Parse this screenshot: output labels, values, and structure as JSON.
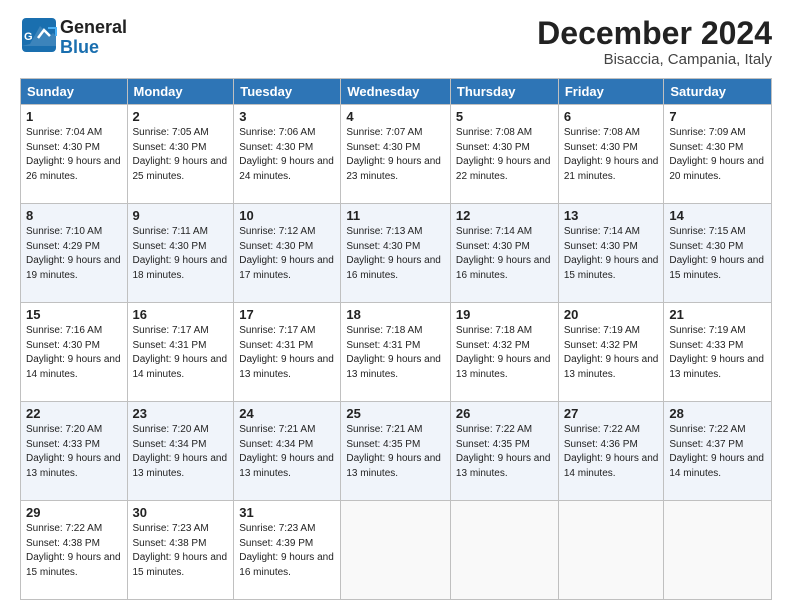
{
  "header": {
    "logo_general": "General",
    "logo_blue": "Blue",
    "month_title": "December 2024",
    "location": "Bisaccia, Campania, Italy"
  },
  "weekdays": [
    "Sunday",
    "Monday",
    "Tuesday",
    "Wednesday",
    "Thursday",
    "Friday",
    "Saturday"
  ],
  "weeks": [
    [
      {
        "day": "1",
        "sunrise": "7:04 AM",
        "sunset": "4:30 PM",
        "daylight": "9 hours and 26 minutes."
      },
      {
        "day": "2",
        "sunrise": "7:05 AM",
        "sunset": "4:30 PM",
        "daylight": "9 hours and 25 minutes."
      },
      {
        "day": "3",
        "sunrise": "7:06 AM",
        "sunset": "4:30 PM",
        "daylight": "9 hours and 24 minutes."
      },
      {
        "day": "4",
        "sunrise": "7:07 AM",
        "sunset": "4:30 PM",
        "daylight": "9 hours and 23 minutes."
      },
      {
        "day": "5",
        "sunrise": "7:08 AM",
        "sunset": "4:30 PM",
        "daylight": "9 hours and 22 minutes."
      },
      {
        "day": "6",
        "sunrise": "7:08 AM",
        "sunset": "4:30 PM",
        "daylight": "9 hours and 21 minutes."
      },
      {
        "day": "7",
        "sunrise": "7:09 AM",
        "sunset": "4:30 PM",
        "daylight": "9 hours and 20 minutes."
      }
    ],
    [
      {
        "day": "8",
        "sunrise": "7:10 AM",
        "sunset": "4:29 PM",
        "daylight": "9 hours and 19 minutes."
      },
      {
        "day": "9",
        "sunrise": "7:11 AM",
        "sunset": "4:30 PM",
        "daylight": "9 hours and 18 minutes."
      },
      {
        "day": "10",
        "sunrise": "7:12 AM",
        "sunset": "4:30 PM",
        "daylight": "9 hours and 17 minutes."
      },
      {
        "day": "11",
        "sunrise": "7:13 AM",
        "sunset": "4:30 PM",
        "daylight": "9 hours and 16 minutes."
      },
      {
        "day": "12",
        "sunrise": "7:14 AM",
        "sunset": "4:30 PM",
        "daylight": "9 hours and 16 minutes."
      },
      {
        "day": "13",
        "sunrise": "7:14 AM",
        "sunset": "4:30 PM",
        "daylight": "9 hours and 15 minutes."
      },
      {
        "day": "14",
        "sunrise": "7:15 AM",
        "sunset": "4:30 PM",
        "daylight": "9 hours and 15 minutes."
      }
    ],
    [
      {
        "day": "15",
        "sunrise": "7:16 AM",
        "sunset": "4:30 PM",
        "daylight": "9 hours and 14 minutes."
      },
      {
        "day": "16",
        "sunrise": "7:17 AM",
        "sunset": "4:31 PM",
        "daylight": "9 hours and 14 minutes."
      },
      {
        "day": "17",
        "sunrise": "7:17 AM",
        "sunset": "4:31 PM",
        "daylight": "9 hours and 13 minutes."
      },
      {
        "day": "18",
        "sunrise": "7:18 AM",
        "sunset": "4:31 PM",
        "daylight": "9 hours and 13 minutes."
      },
      {
        "day": "19",
        "sunrise": "7:18 AM",
        "sunset": "4:32 PM",
        "daylight": "9 hours and 13 minutes."
      },
      {
        "day": "20",
        "sunrise": "7:19 AM",
        "sunset": "4:32 PM",
        "daylight": "9 hours and 13 minutes."
      },
      {
        "day": "21",
        "sunrise": "7:19 AM",
        "sunset": "4:33 PM",
        "daylight": "9 hours and 13 minutes."
      }
    ],
    [
      {
        "day": "22",
        "sunrise": "7:20 AM",
        "sunset": "4:33 PM",
        "daylight": "9 hours and 13 minutes."
      },
      {
        "day": "23",
        "sunrise": "7:20 AM",
        "sunset": "4:34 PM",
        "daylight": "9 hours and 13 minutes."
      },
      {
        "day": "24",
        "sunrise": "7:21 AM",
        "sunset": "4:34 PM",
        "daylight": "9 hours and 13 minutes."
      },
      {
        "day": "25",
        "sunrise": "7:21 AM",
        "sunset": "4:35 PM",
        "daylight": "9 hours and 13 minutes."
      },
      {
        "day": "26",
        "sunrise": "7:22 AM",
        "sunset": "4:35 PM",
        "daylight": "9 hours and 13 minutes."
      },
      {
        "day": "27",
        "sunrise": "7:22 AM",
        "sunset": "4:36 PM",
        "daylight": "9 hours and 14 minutes."
      },
      {
        "day": "28",
        "sunrise": "7:22 AM",
        "sunset": "4:37 PM",
        "daylight": "9 hours and 14 minutes."
      }
    ],
    [
      {
        "day": "29",
        "sunrise": "7:22 AM",
        "sunset": "4:38 PM",
        "daylight": "9 hours and 15 minutes."
      },
      {
        "day": "30",
        "sunrise": "7:23 AM",
        "sunset": "4:38 PM",
        "daylight": "9 hours and 15 minutes."
      },
      {
        "day": "31",
        "sunrise": "7:23 AM",
        "sunset": "4:39 PM",
        "daylight": "9 hours and 16 minutes."
      },
      null,
      null,
      null,
      null
    ]
  ],
  "labels": {
    "sunrise": "Sunrise:",
    "sunset": "Sunset:",
    "daylight": "Daylight:"
  }
}
